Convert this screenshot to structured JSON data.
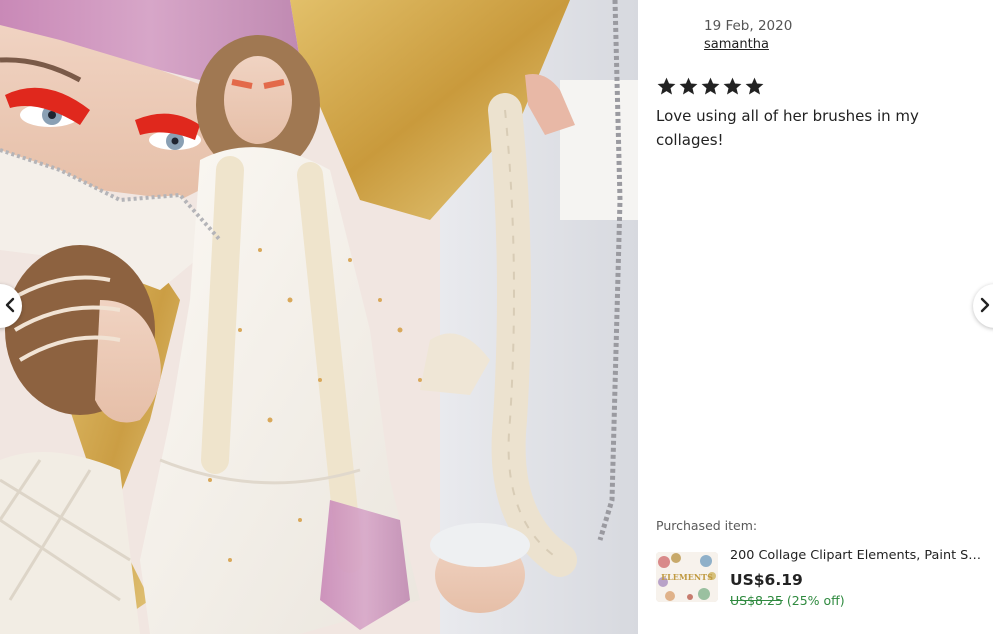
{
  "review": {
    "date": "19 Feb, 2020",
    "username": "samantha",
    "rating": 5,
    "text": "Love using all of her brushes in my collages!"
  },
  "purchase": {
    "label": "Purchased item:",
    "title": "200 Collage Clipart Elements, Paint St...",
    "price": "US$6.19",
    "original_price": "US$8.25",
    "discount": "(25% off)",
    "thumbnail_text": "ELEMENTS"
  },
  "icons": {
    "prev": "chevron-left-icon",
    "next": "chevron-right-icon",
    "star": "star-icon"
  },
  "colors": {
    "discount_green": "#2f8a3f",
    "star": "#222222",
    "gold": "#d4ad4a",
    "pink_glitter": "#c890b8"
  }
}
